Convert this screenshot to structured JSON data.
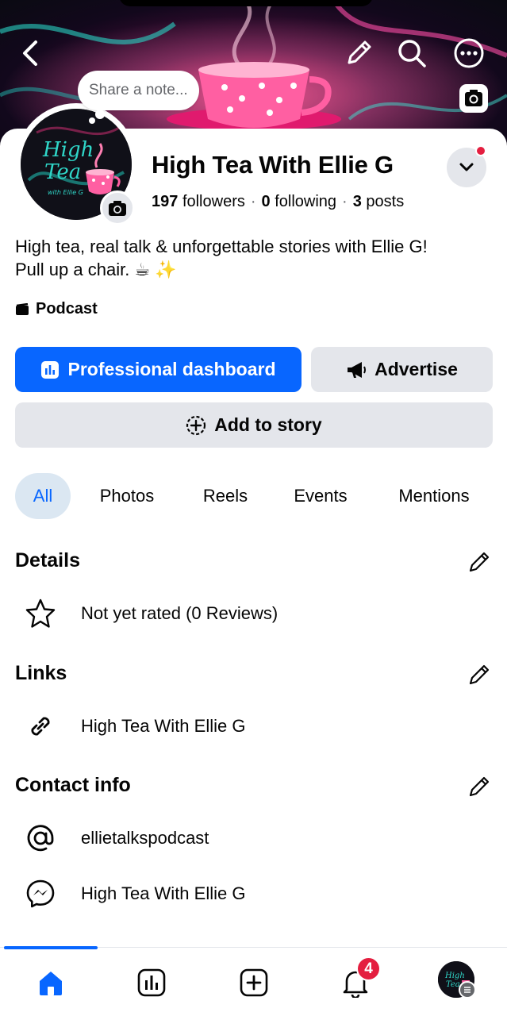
{
  "cover": {
    "note_placeholder": "Share a note..."
  },
  "avatar": {
    "logo_text": "High Tea",
    "logo_subtext": "with Ellie G"
  },
  "profile": {
    "name": "High Tea With Ellie G",
    "followers_count": "197",
    "followers_label": "followers",
    "following_count": "0",
    "following_label": "following",
    "posts_count": "3",
    "posts_label": "posts",
    "bio_line1": "High tea, real talk & unforgettable stories with Ellie G!",
    "bio_line2": "Pull up a chair. ☕ ✨",
    "category": "Podcast"
  },
  "actions": {
    "professional_dashboard": "Professional dashboard",
    "advertise": "Advertise",
    "add_to_story": "Add to story"
  },
  "tabs": [
    "All",
    "Photos",
    "Reels",
    "Events",
    "Mentions"
  ],
  "details": {
    "title": "Details",
    "rating": "Not yet rated (0 Reviews)"
  },
  "links": {
    "title": "Links",
    "link_text": "High Tea With Ellie G"
  },
  "contact": {
    "title": "Contact info",
    "instagram": "ellietalkspodcast",
    "messenger": "High Tea With Ellie G"
  },
  "nav": {
    "notifications_badge": "4"
  },
  "colors": {
    "accent": "#0866ff",
    "badge": "#e41e3f",
    "surface": "#e4e6eb"
  }
}
